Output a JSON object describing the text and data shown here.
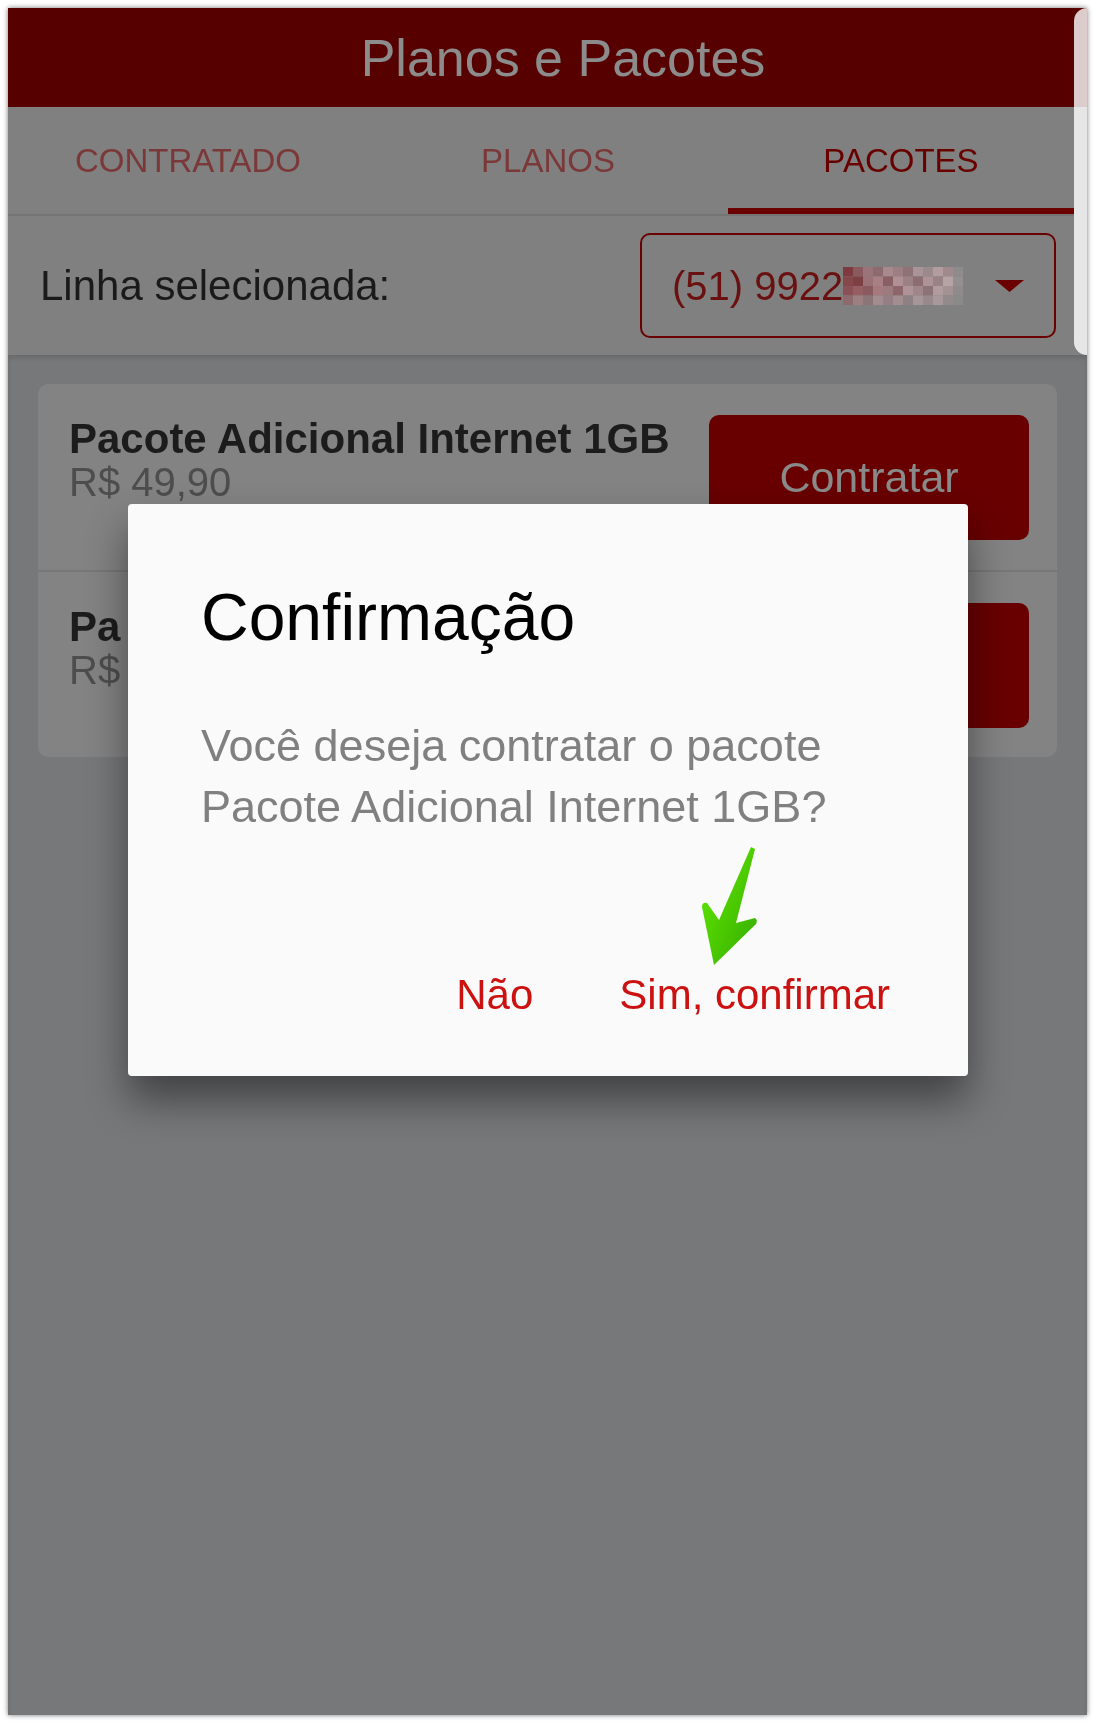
{
  "header": {
    "title": "Planos e Pacotes"
  },
  "tabs": [
    {
      "label": "CONTRATADO",
      "selected": false
    },
    {
      "label": "PLANOS",
      "selected": false
    },
    {
      "label": "PACOTES",
      "selected": true
    }
  ],
  "line_selector": {
    "label": "Linha selecionada:",
    "value": "(51) 9922"
  },
  "packages": [
    {
      "name": "Pacote Adicional Internet 1GB",
      "price": "R$ 49,90",
      "button": "Contratar"
    },
    {
      "name": "Pa",
      "price": "R$"
    }
  ],
  "dialog": {
    "title": "Confirmação",
    "message": "Você deseja contratar o pacote Pacote Adicional Internet 1GB?",
    "buttons": [
      "Não",
      "Sim, confirmar"
    ]
  }
}
